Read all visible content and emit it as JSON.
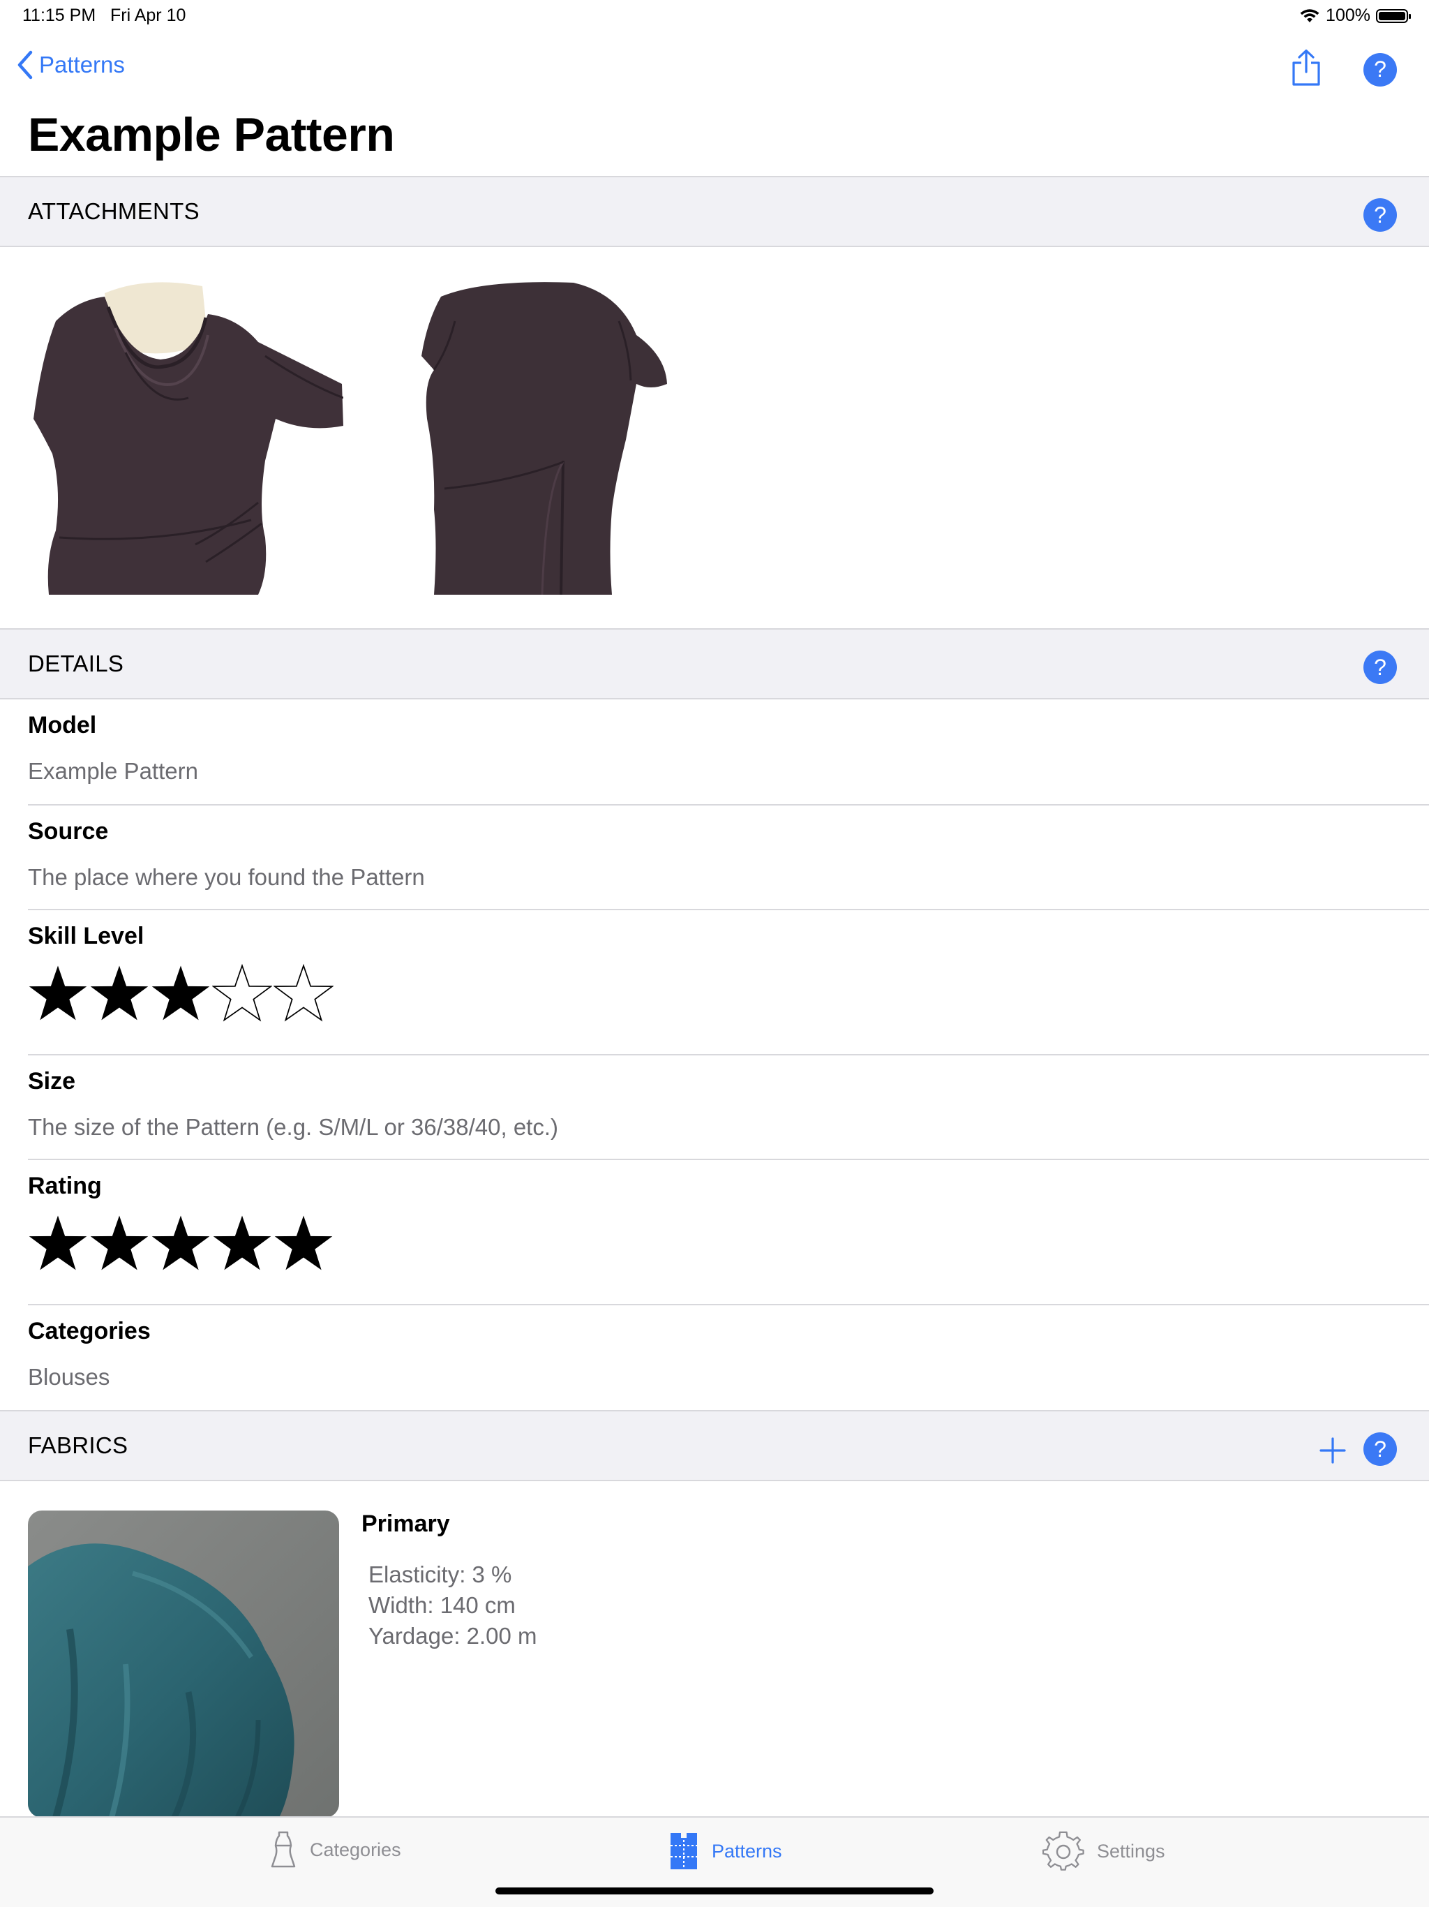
{
  "status_bar": {
    "time": "11:15 PM",
    "date": "Fri Apr 10",
    "battery": "100%",
    "icons": [
      "wifi-icon",
      "battery-icon"
    ]
  },
  "nav": {
    "back_label": "Patterns",
    "title": "Example Pattern",
    "icons": [
      "chevron-left-icon",
      "share-icon",
      "help-icon"
    ]
  },
  "sections": {
    "attachments": {
      "title": "ATTACHMENTS"
    },
    "details": {
      "title": "DETAILS"
    },
    "fabrics": {
      "title": "FABRICS"
    }
  },
  "attachments": [
    {
      "label": "dress-front-photo"
    },
    {
      "label": "dress-back-photo"
    }
  ],
  "details": {
    "model": {
      "label": "Model",
      "value": "Example Pattern"
    },
    "source": {
      "label": "Source",
      "value": "The place where you found the Pattern"
    },
    "skill_level": {
      "label": "Skill Level",
      "value": 3,
      "max": 5
    },
    "size": {
      "label": "Size",
      "value": "The size of the Pattern (e.g. S/M/L or 36/38/40, etc.)"
    },
    "rating": {
      "label": "Rating",
      "value": 5,
      "max": 5
    },
    "categories": {
      "label": "Categories",
      "value": "Blouses"
    }
  },
  "fabric": {
    "title": "Primary",
    "elasticity": "Elasticity: 3 %",
    "width": "Width: 140 cm",
    "yardage": "Yardage: 2.00 m"
  },
  "tab_bar": {
    "tabs": [
      {
        "label": "Categories",
        "icon": "dress-form-icon",
        "active": false
      },
      {
        "label": "Patterns",
        "icon": "pattern-icon",
        "active": true
      },
      {
        "label": "Settings",
        "icon": "gear-icon",
        "active": false
      }
    ]
  },
  "colors": {
    "accent": "#3478f6",
    "section_bg": "#f1f1f5",
    "secondary_text": "#6b6b70",
    "dress": "#3d3038",
    "fabric": "#2c6470"
  }
}
